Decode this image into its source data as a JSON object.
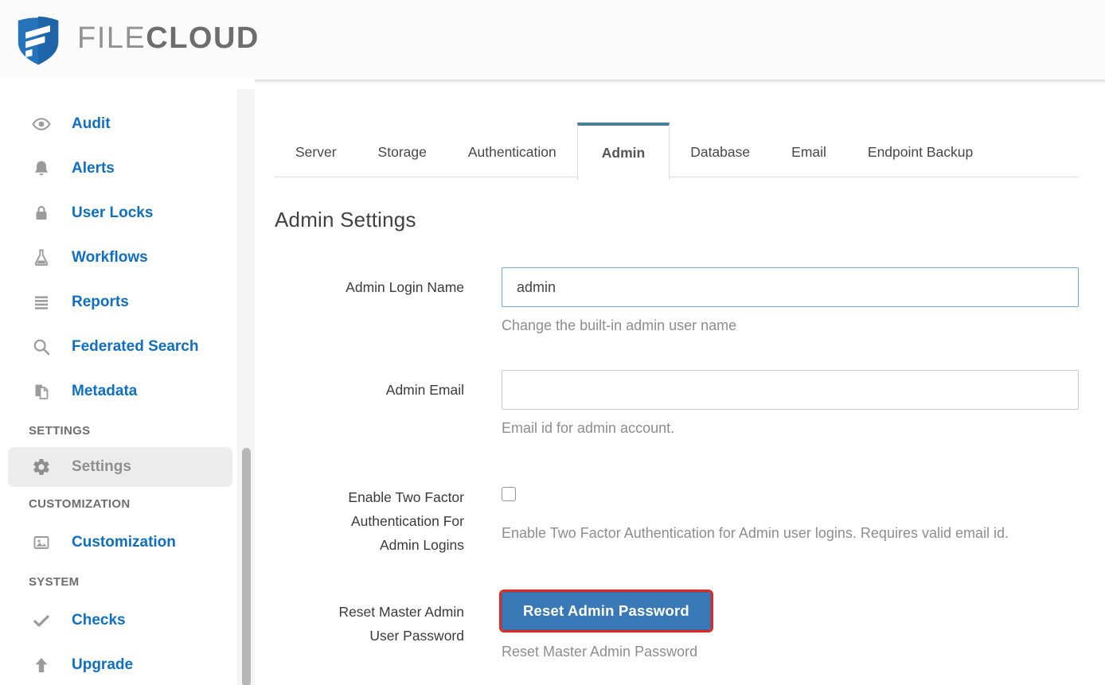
{
  "brand": {
    "file": "FILE",
    "cloud": "CLOUD"
  },
  "colors": {
    "link_blue": "#0e6fc4",
    "button_blue": "#3a79b7",
    "highlight_red": "#e4281e",
    "active_tab_accent": "#4b7f97",
    "selected_item_bg": "#ececec",
    "icon_gray": "#9b9b9b"
  },
  "sidebar": {
    "items": [
      {
        "label": "Audit",
        "icon": "eye"
      },
      {
        "label": "Alerts",
        "icon": "bell"
      },
      {
        "label": "User Locks",
        "icon": "lock"
      },
      {
        "label": "Workflows",
        "icon": "flask"
      },
      {
        "label": "Reports",
        "icon": "list"
      },
      {
        "label": "Federated Search",
        "icon": "search"
      },
      {
        "label": "Metadata",
        "icon": "pages"
      },
      {
        "label": "Settings",
        "icon": "gear",
        "selected": true
      },
      {
        "label": "Customization",
        "icon": "image"
      },
      {
        "label": "Checks",
        "icon": "check"
      },
      {
        "label": "Upgrade",
        "icon": "arrow-up"
      }
    ],
    "section_labels": {
      "settings": "SETTINGS",
      "customization": "CUSTOMIZATION",
      "system": "SYSTEM"
    }
  },
  "tabs": {
    "items": [
      "Server",
      "Storage",
      "Authentication",
      "Admin",
      "Database",
      "Email",
      "Endpoint Backup"
    ],
    "active": "Admin"
  },
  "admin_settings": {
    "heading": "Admin Settings",
    "admin_login_name": {
      "label": "Admin Login Name",
      "value": "admin",
      "help": "Change the built-in admin user name"
    },
    "admin_email": {
      "label": "Admin Email",
      "value": "",
      "help": "Email id for admin account."
    },
    "two_factor": {
      "label": "Enable Two Factor Authentication For Admin Logins",
      "checked": false,
      "help": "Enable Two Factor Authentication for Admin user logins. Requires valid email id."
    },
    "reset_admin": {
      "label": "Reset Master Admin User Password",
      "button_label": "Reset Admin Password",
      "help": "Reset Master Admin Password"
    }
  }
}
